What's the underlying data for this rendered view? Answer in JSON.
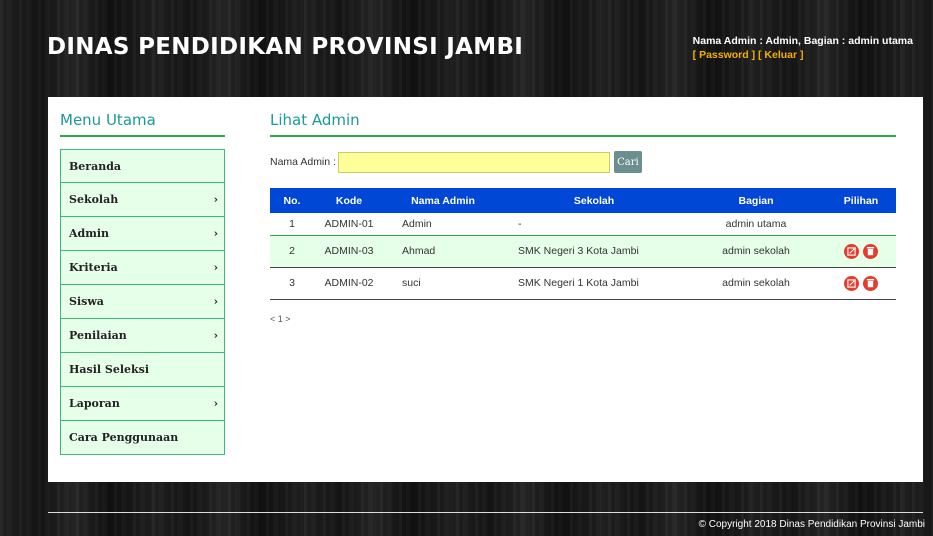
{
  "header": {
    "site_title": "DINAS PENDIDIKAN PROVINSI JAMBI",
    "admin_info": "Nama Admin : Admin, Bagian : admin utama",
    "password_link": "[ Password ]",
    "logout_link": "[ Keluar ]"
  },
  "sidebar": {
    "title": "Menu Utama",
    "items": [
      {
        "label": "Beranda",
        "has_arrow": false
      },
      {
        "label": "Sekolah",
        "has_arrow": true
      },
      {
        "label": "Admin",
        "has_arrow": true
      },
      {
        "label": "Kriteria",
        "has_arrow": true
      },
      {
        "label": "Siswa",
        "has_arrow": true
      },
      {
        "label": "Penilaian",
        "has_arrow": true
      },
      {
        "label": "Hasil Seleksi",
        "has_arrow": false
      },
      {
        "label": "Laporan",
        "has_arrow": true
      },
      {
        "label": "Cara Penggunaan",
        "has_arrow": false
      }
    ],
    "arrow_glyph": "›"
  },
  "main": {
    "title": "Lihat Admin",
    "search": {
      "label": "Nama Admin :",
      "value": "",
      "button": "Cari"
    },
    "table": {
      "columns": [
        "No.",
        "Kode",
        "Nama Admin",
        "Sekolah",
        "Bagian",
        "Pilihan"
      ],
      "rows": [
        {
          "no": "1",
          "kode": "ADMIN-01",
          "nama": "Admin",
          "sekolah": "-",
          "bagian": "admin utama",
          "actions": false
        },
        {
          "no": "2",
          "kode": "ADMIN-03",
          "nama": "Ahmad",
          "sekolah": "SMK Negeri 3 Kota Jambi",
          "bagian": "admin sekolah",
          "actions": true
        },
        {
          "no": "3",
          "kode": "ADMIN-02",
          "nama": "suci",
          "sekolah": "SMK Negeri 1 Kota Jambi",
          "bagian": "admin sekolah",
          "actions": true
        }
      ]
    },
    "pagination": "< 1 >"
  },
  "footer": {
    "copyright": "© Copyright 2018 Dinas Pendidikan Provinsi Jambi"
  },
  "colors": {
    "accent_teal": "#1a9a9a",
    "accent_green": "#2aa84a",
    "table_header": "#0047d6",
    "action_red": "#e53a2c",
    "header_link": "#f5b000"
  }
}
